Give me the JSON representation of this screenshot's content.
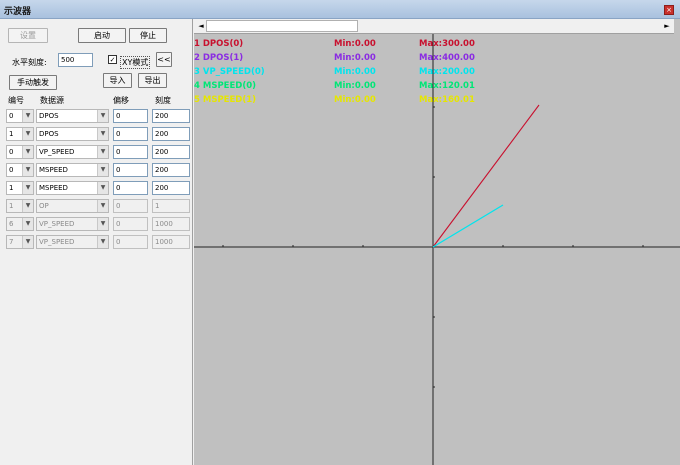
{
  "window": {
    "title": "示波器",
    "close_glyph": "×"
  },
  "controls": {
    "settings": "设置",
    "start": "启动",
    "stop": "停止",
    "h_scale_label": "水平刻度:",
    "h_scale_value": "500",
    "xy_mode_label": "XY模式",
    "xy_mode_checked": true,
    "collapse": "<<",
    "manual_trigger": "手动触发",
    "import": "导入",
    "export": "导出"
  },
  "table": {
    "headers": [
      "编号",
      "数据源",
      "偏移",
      "刻度"
    ],
    "rows": [
      {
        "num": "0",
        "source": "DPOS",
        "offset": "0",
        "scale": "200",
        "enabled": true
      },
      {
        "num": "1",
        "source": "DPOS",
        "offset": "0",
        "scale": "200",
        "enabled": true
      },
      {
        "num": "0",
        "source": "VP_SPEED",
        "offset": "0",
        "scale": "200",
        "enabled": true
      },
      {
        "num": "0",
        "source": "MSPEED",
        "offset": "0",
        "scale": "200",
        "enabled": true
      },
      {
        "num": "1",
        "source": "MSPEED",
        "offset": "0",
        "scale": "200",
        "enabled": true
      },
      {
        "num": "1",
        "source": "OP",
        "offset": "0",
        "scale": "1",
        "enabled": false
      },
      {
        "num": "6",
        "source": "VP_SPEED",
        "offset": "0",
        "scale": "1000",
        "enabled": false
      },
      {
        "num": "7",
        "source": "VP_SPEED",
        "offset": "0",
        "scale": "1000",
        "enabled": false
      }
    ]
  },
  "legend": [
    {
      "name": "1 DPOS(0)",
      "min": "Min:0.00",
      "max": "Max:300.00",
      "color": "#c8102e"
    },
    {
      "name": "2 DPOS(1)",
      "min": "Min:0.00",
      "max": "Max:400.00",
      "color": "#8a2be2"
    },
    {
      "name": "3 VP_SPEED(0)",
      "min": "Min:0.00",
      "max": "Max:200.00",
      "color": "#00e5ee"
    },
    {
      "name": "4 MSPEED(0)",
      "min": "Min:0.00",
      "max": "Max:120.01",
      "color": "#00e676"
    },
    {
      "name": "5 MSPEED(1)",
      "min": "Min:0.00",
      "max": "Max:160.01",
      "color": "#e6e600"
    }
  ],
  "scroll": {
    "left_arrow": "◄",
    "right_arrow": "►"
  },
  "icons": {
    "dropdown": "▼",
    "check": "✓"
  },
  "trace_color_a": "#c8102e",
  "trace_color_b": "#00e5ee"
}
